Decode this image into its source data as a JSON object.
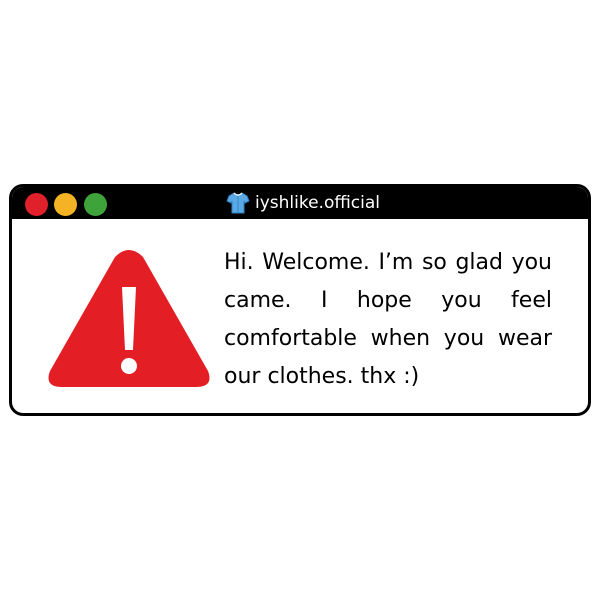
{
  "window": {
    "title": "iyshlike.official",
    "title_icon": "shirt-icon",
    "controls": [
      {
        "name": "close",
        "color": "#e0202b"
      },
      {
        "name": "minimize",
        "color": "#f4b324"
      },
      {
        "name": "maximize",
        "color": "#3fa33c"
      }
    ]
  },
  "dialog": {
    "icon": "warning-icon",
    "icon_color": "#e31e24",
    "message": "Hi. Welcome. I’m so glad you came. I hope you feel comfortable when you wear our clothes. thx :)"
  }
}
